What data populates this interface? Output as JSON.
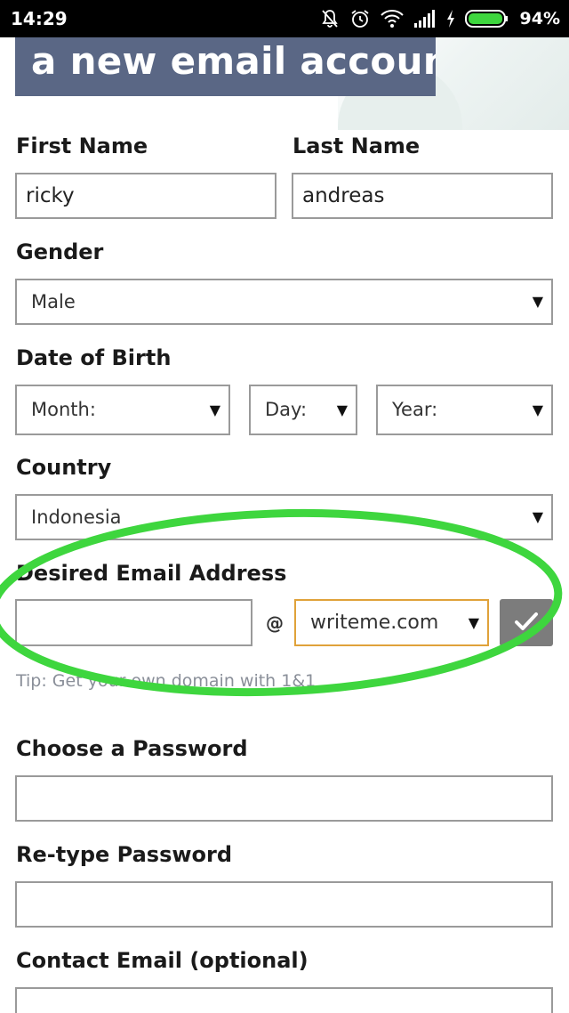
{
  "status_bar": {
    "time": "14:29",
    "battery_pct": "94%",
    "icons": [
      "notifications-off-icon",
      "alarm-icon",
      "wifi-icon",
      "signal-icon",
      "charging-icon",
      "battery-icon"
    ]
  },
  "header": {
    "title": "a new email account"
  },
  "form": {
    "first_name": {
      "label": "First Name",
      "value": "ricky"
    },
    "last_name": {
      "label": "Last Name",
      "value": "andreas"
    },
    "gender": {
      "label": "Gender",
      "value": "Male"
    },
    "dob": {
      "label": "Date of Birth",
      "month": "Month:",
      "day": "Day:",
      "year": "Year:"
    },
    "country": {
      "label": "Country",
      "value": "Indonesia"
    },
    "email": {
      "label": "Desired Email Address",
      "value": "",
      "at": "@",
      "domain": "writeme.com",
      "tip": "Tip: Get your own domain with 1&1"
    },
    "password": {
      "label": "Choose a Password",
      "value": ""
    },
    "retype_password": {
      "label": "Re-type Password",
      "value": ""
    },
    "contact_email": {
      "label": "Contact Email (optional)",
      "value": ""
    }
  },
  "colors": {
    "title_bg": "#5a6785",
    "highlight": "#3ed63e",
    "domain_border": "#e0a23a",
    "check_bg": "#7c7c7c"
  }
}
